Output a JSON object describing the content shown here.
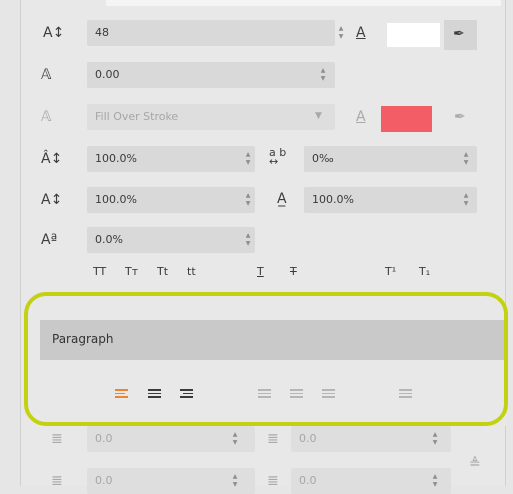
{
  "text_panel": {
    "font_size": {
      "value": "48",
      "icon": "font-size-icon"
    },
    "fill_color_icon": "fill-color-icon",
    "fill_color": "#ffffff",
    "eyedropper_icon": "eyedropper-icon",
    "stroke_width": {
      "value": "0.00",
      "icon": "stroke-icon"
    },
    "stroke_mode": {
      "value": "Fill Over Stroke",
      "icon": "stroke-mode-icon"
    },
    "stroke_color": "#f35e66",
    "vertical_scale": {
      "value": "100.0%",
      "icon": "vertical-scale-icon"
    },
    "tracking": {
      "label": "a b",
      "value": "0‰",
      "icon": "tracking-icon"
    },
    "leading": {
      "value": "100.0%",
      "icon": "leading-icon"
    },
    "horizontal_scale": {
      "value": "100.0%",
      "icon": "horizontal-scale-icon"
    },
    "baseline_shift": {
      "value": "0.0%",
      "icon": "baseline-shift-icon"
    },
    "case_buttons": [
      "TT",
      "Tт",
      "Tt",
      "tt"
    ],
    "style_buttons": [
      "T",
      "T"
    ],
    "script_buttons": [
      "T¹",
      "T₁"
    ]
  },
  "paragraph": {
    "title": "Paragraph",
    "align_buttons": [
      "align-left",
      "align-center",
      "align-right",
      "justify-left",
      "justify-center",
      "justify-right",
      "justify-all"
    ],
    "active_align": "align-left",
    "accent_color": "#ef8330"
  },
  "indents": {
    "left_indent": "0.0",
    "right_indent": "0.0",
    "first_line": "0.0",
    "space_before": "0.0"
  },
  "highlight_color": "#c4d113"
}
